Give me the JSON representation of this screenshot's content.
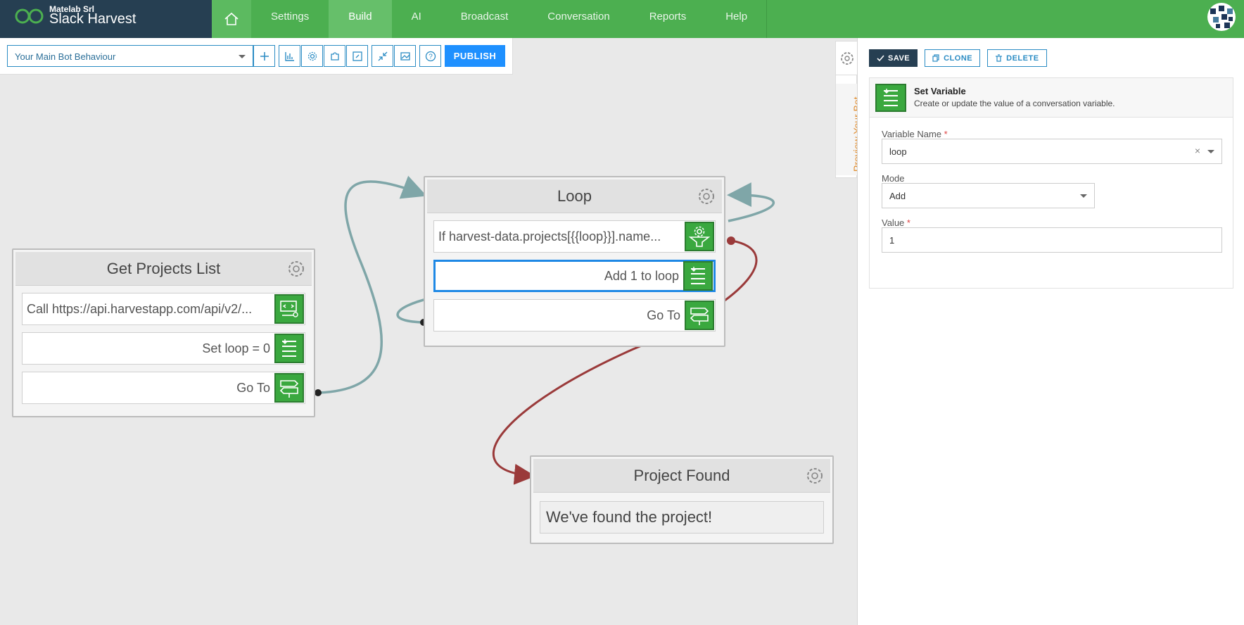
{
  "brand": {
    "company": "Matelab Srl",
    "product": "Slack Harvest"
  },
  "nav": {
    "items": [
      {
        "label": "Settings"
      },
      {
        "label": "Build"
      },
      {
        "label": "AI"
      },
      {
        "label": "Broadcast"
      },
      {
        "label": "Conversation"
      },
      {
        "label": "Reports"
      },
      {
        "label": "Help"
      }
    ],
    "active": "Build"
  },
  "toolbar": {
    "bot_select_value": "Your Main Bot Behaviour",
    "publish_label": "PUBLISH",
    "icons": [
      "add-icon",
      "chart-icon",
      "gear-icon",
      "puzzle-icon",
      "edit-icon",
      "collapse-icon",
      "image-icon",
      "help-icon"
    ]
  },
  "nodes": {
    "get_projects": {
      "title": "Get Projects List",
      "rows": [
        {
          "text": "Call https://api.harvestapp.com/api/v2/...",
          "icon": "api-call-icon"
        },
        {
          "text": "Set loop = 0",
          "icon": "set-variable-icon"
        },
        {
          "text": "Go To",
          "icon": "goto-sign-icon"
        }
      ]
    },
    "loop": {
      "title": "Loop",
      "rows": [
        {
          "text": "If harvest-data.projects[{{loop}}].name...",
          "icon": "condition-icon"
        },
        {
          "text": "Add 1 to loop",
          "icon": "set-variable-icon"
        },
        {
          "text": "Go To",
          "icon": "goto-sign-icon"
        }
      ]
    },
    "project_found": {
      "title": "Project Found",
      "text": "We've found the project!"
    }
  },
  "side_tab": {
    "preview_label": "Preview Your Bot"
  },
  "panel": {
    "actions": {
      "save": "SAVE",
      "clone": "CLONE",
      "delete": "DELETE"
    },
    "card": {
      "title": "Set Variable",
      "description": "Create or update the value of a conversation variable."
    },
    "fields": {
      "variable_name": {
        "label": "Variable Name",
        "required_mark": "*",
        "value": "loop"
      },
      "mode": {
        "label": "Mode",
        "value": "Add"
      },
      "value": {
        "label": "Value",
        "required_mark": "*",
        "value": "1"
      }
    }
  },
  "colors": {
    "nav_green": "#4caf50",
    "brand_dark": "#263f52",
    "action_icon_green": "#3aa83f",
    "connector_teal": "#7fa6a8",
    "connector_red": "#9a3a3a",
    "selected_blue": "#1e88e5",
    "publish_blue": "#1e90ff"
  }
}
